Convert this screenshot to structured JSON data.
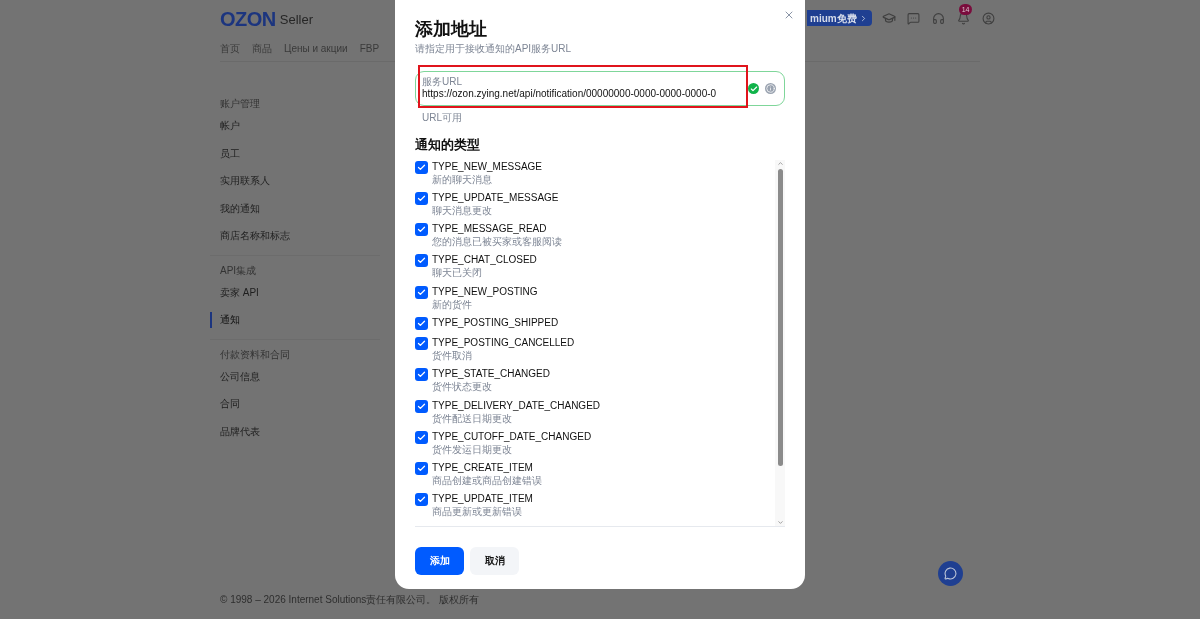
{
  "header": {
    "logo": "OZON",
    "logo_suffix": "Seller",
    "premium_button": "mium免费",
    "notification_badge": "14"
  },
  "nav": [
    {
      "label": "首页",
      "selected": false
    },
    {
      "label": "商品",
      "selected": false
    },
    {
      "label": "Цены и акции",
      "selected": false
    },
    {
      "label": "FBP",
      "selected": false
    }
  ],
  "sidebar": [
    {
      "heading": "账户管理",
      "items": [
        {
          "label": "帐户",
          "selected": false
        },
        {
          "label": "员工",
          "selected": false
        },
        {
          "label": "实用联系人",
          "selected": false
        },
        {
          "label": "我的通知",
          "selected": false
        },
        {
          "label": "商店名称和标志",
          "selected": false
        }
      ]
    },
    {
      "heading": "API集成",
      "items": [
        {
          "label": "卖家 API",
          "selected": false
        },
        {
          "label": "通知",
          "selected": true
        }
      ]
    },
    {
      "heading": "付款资料和合同",
      "items": [
        {
          "label": "公司信息",
          "selected": false
        },
        {
          "label": "合同",
          "selected": false
        },
        {
          "label": "品牌代表",
          "selected": false
        }
      ]
    }
  ],
  "footer": "© 1998 – 2026 Internet Solutions责任有限公司。 版权所有",
  "dialog": {
    "title": "添加地址",
    "subtitle": "请指定用于接收通知的API服务URL",
    "url_field": {
      "label": "服务URL",
      "value": "https://ozon.zying.net/api/notification/00000000-0000-0000-0000-0",
      "valid": true,
      "highlighted": true
    },
    "url_hint": "URL可用",
    "section_title": "通知的类型",
    "types": [
      {
        "name": "TYPE_NEW_MESSAGE",
        "description": "新的聊天消息",
        "checked": true
      },
      {
        "name": "TYPE_UPDATE_MESSAGE",
        "description": "聊天消息更改",
        "checked": true
      },
      {
        "name": "TYPE_MESSAGE_READ",
        "description": "您的消息已被买家或客服阅读",
        "checked": true
      },
      {
        "name": "TYPE_CHAT_CLOSED",
        "description": "聊天已关闭",
        "checked": true
      },
      {
        "name": "TYPE_NEW_POSTING",
        "description": "新的货件",
        "checked": true
      },
      {
        "name": "TYPE_POSTING_SHIPPED",
        "checked": true
      },
      {
        "name": "TYPE_POSTING_CANCELLED",
        "description": "货件取消",
        "checked": true
      },
      {
        "name": "TYPE_STATE_CHANGED",
        "description": "货件状态更改",
        "checked": true
      },
      {
        "name": "TYPE_DELIVERY_DATE_CHANGED",
        "description": "货件配送日期更改",
        "checked": true
      },
      {
        "name": "TYPE_CUTOFF_DATE_CHANGED",
        "description": "货件发运日期更改",
        "checked": true
      },
      {
        "name": "TYPE_CREATE_ITEM",
        "description": "商品创建或商品创建错误",
        "checked": true
      },
      {
        "name": "TYPE_UPDATE_ITEM",
        "description": "商品更新或更新错误",
        "checked": true
      }
    ],
    "buttons": [
      {
        "label": "添加",
        "kind": "primary"
      },
      {
        "label": "取消",
        "kind": "secondary"
      }
    ]
  }
}
